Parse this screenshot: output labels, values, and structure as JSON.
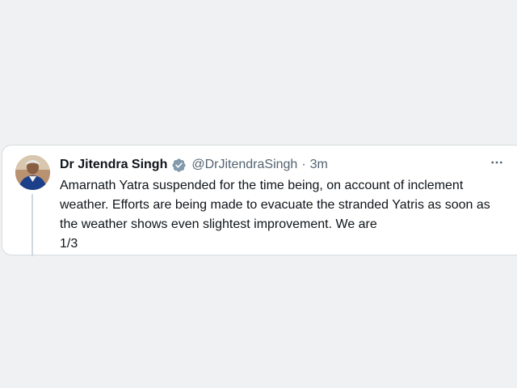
{
  "tweet": {
    "author_name": "Dr Jitendra Singh",
    "handle": "@DrJitendraSingh",
    "separator": "·",
    "time": "3m",
    "text_lines": [
      "Amarnath Yatra suspended for the time being, on account of inclement",
      "weather. Efforts are being made to evacuate the stranded Yatris as soon as",
      "the weather shows even slightest improvement. We are",
      "1/3"
    ],
    "icons": {
      "verified": "verified-badge-icon",
      "more": "more-options-icon"
    },
    "colors": {
      "verified_badge": "#829aab",
      "text": "#0f1419",
      "secondary_text": "#536471",
      "background": "#f0f1f2"
    }
  }
}
